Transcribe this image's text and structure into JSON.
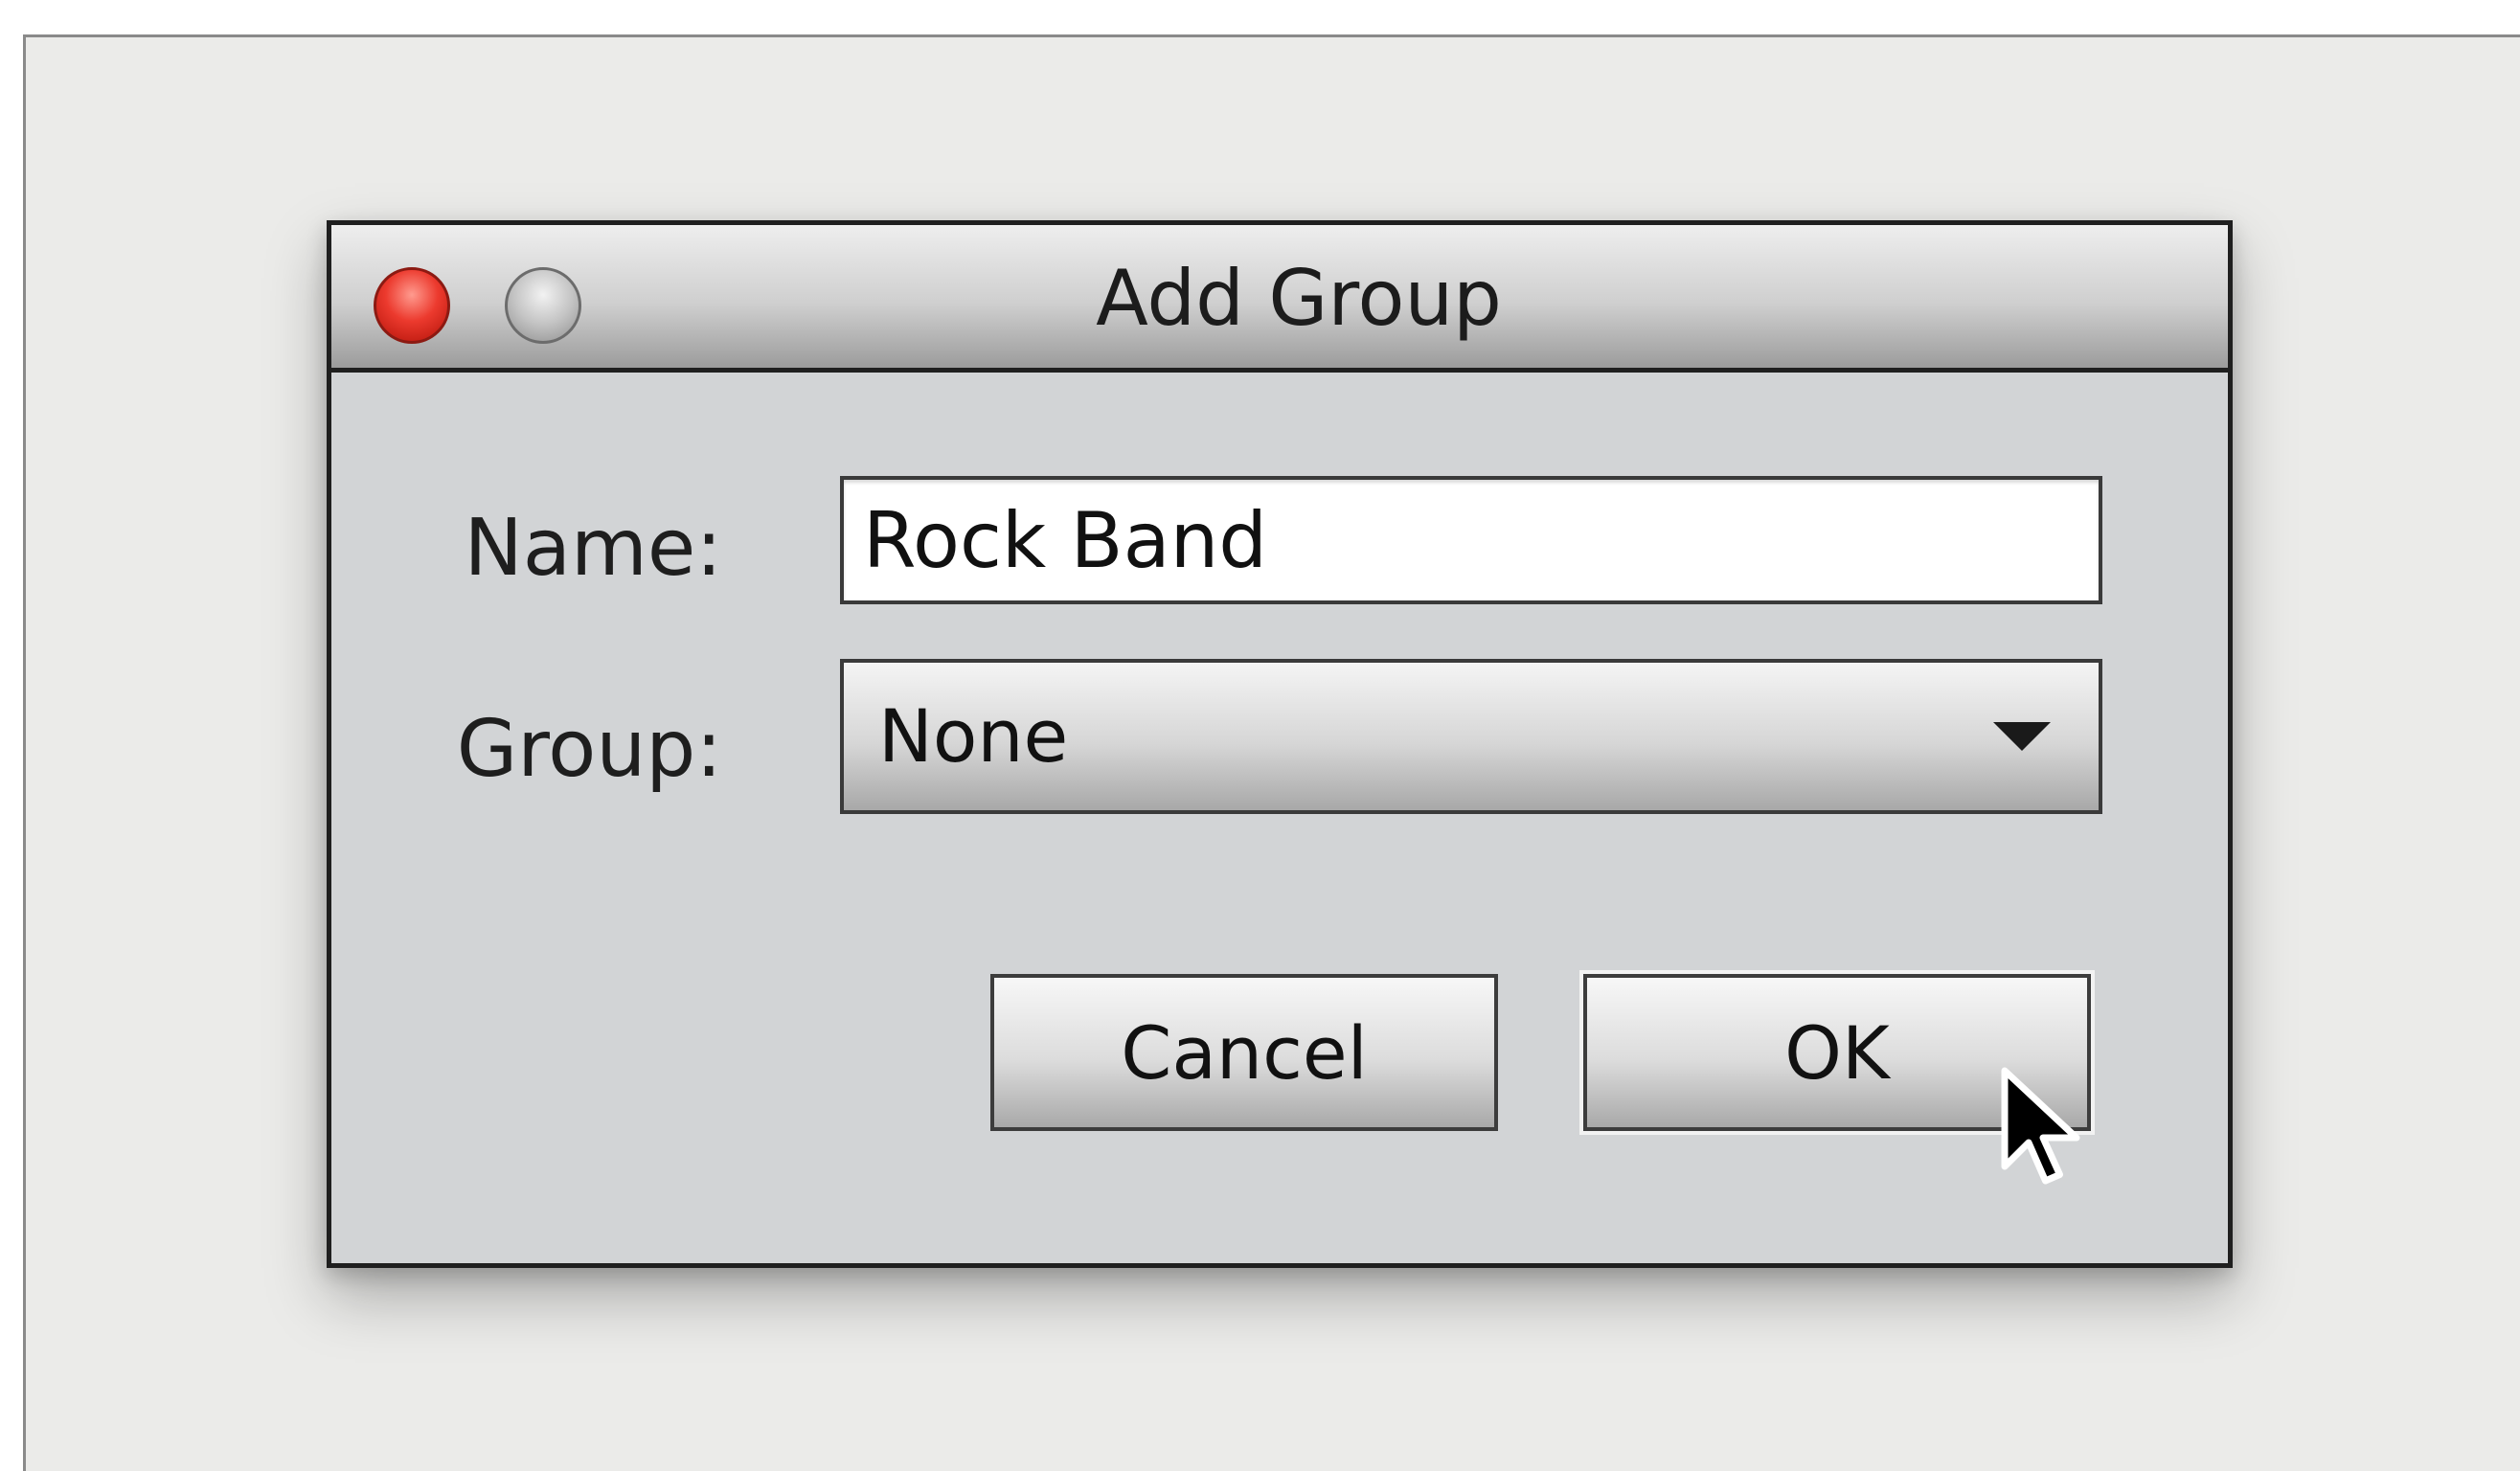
{
  "dialog": {
    "title": "Add Group",
    "name_label": "Name:",
    "name_value": "Rock Band",
    "group_label": "Group:",
    "group_selected": "None",
    "cancel_label": "Cancel",
    "ok_label": "OK"
  },
  "icons": {
    "close": "close-icon",
    "minimize": "minimize-icon",
    "dropdown": "chevron-down-icon",
    "cursor": "mouse-pointer-icon"
  },
  "colors": {
    "close_button": "#ec3a2e",
    "dialog_background": "#d2d4d6",
    "backdrop": "#ebebe9"
  }
}
